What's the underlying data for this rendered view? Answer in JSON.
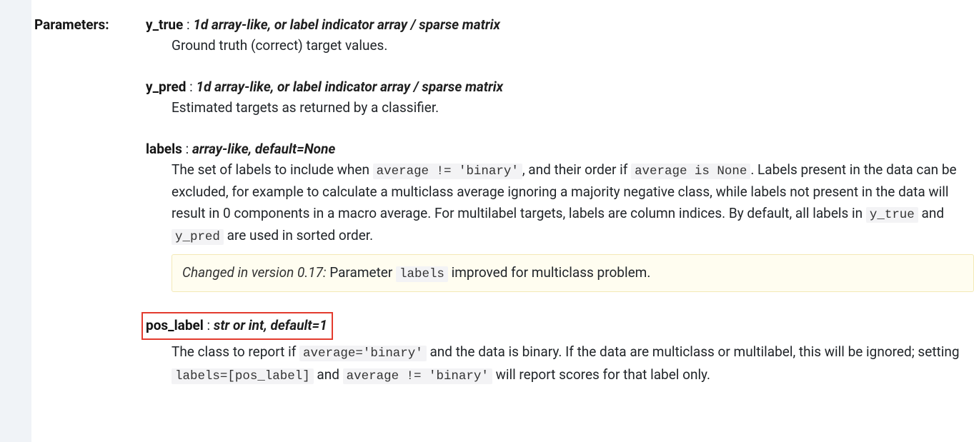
{
  "section_label": "Parameters:",
  "params": {
    "y_true": {
      "name": "y_true",
      "type": "1d array-like, or label indicator array / sparse matrix",
      "desc": "Ground truth (correct) target values."
    },
    "y_pred": {
      "name": "y_pred",
      "type": "1d array-like, or label indicator array / sparse matrix",
      "desc": "Estimated targets as returned by a classifier."
    },
    "labels": {
      "name": "labels",
      "type": "array-like, default=None",
      "desc_1": "The set of labels to include when ",
      "code_1": "average != 'binary'",
      "desc_2": ", and their order if ",
      "code_2": "average is None",
      "desc_3": ". Labels present in the data can be excluded, for example to calculate a multiclass average ignoring a majority negative class, while labels not present in the data will result in 0 components in a macro average. For multilabel targets, labels are column indices. By default, all labels in ",
      "code_3": "y_true",
      "desc_4": " and ",
      "code_4": "y_pred",
      "desc_5": " are used in sorted order.",
      "changed_prefix": "Changed in version 0.17:",
      "changed_text_1": " Parameter ",
      "changed_code": "labels",
      "changed_text_2": " improved for multiclass problem."
    },
    "pos_label": {
      "name": "pos_label",
      "type": "str or int, default=1",
      "desc_1": "The class to report if ",
      "code_1": "average='binary'",
      "desc_2": " and the data is binary. If the data are multiclass or multilabel, this will be ignored; setting ",
      "code_2": "labels=[pos_label]",
      "desc_3": " and ",
      "code_3": "average != 'binary'",
      "desc_4": " will report scores for that label only."
    }
  }
}
